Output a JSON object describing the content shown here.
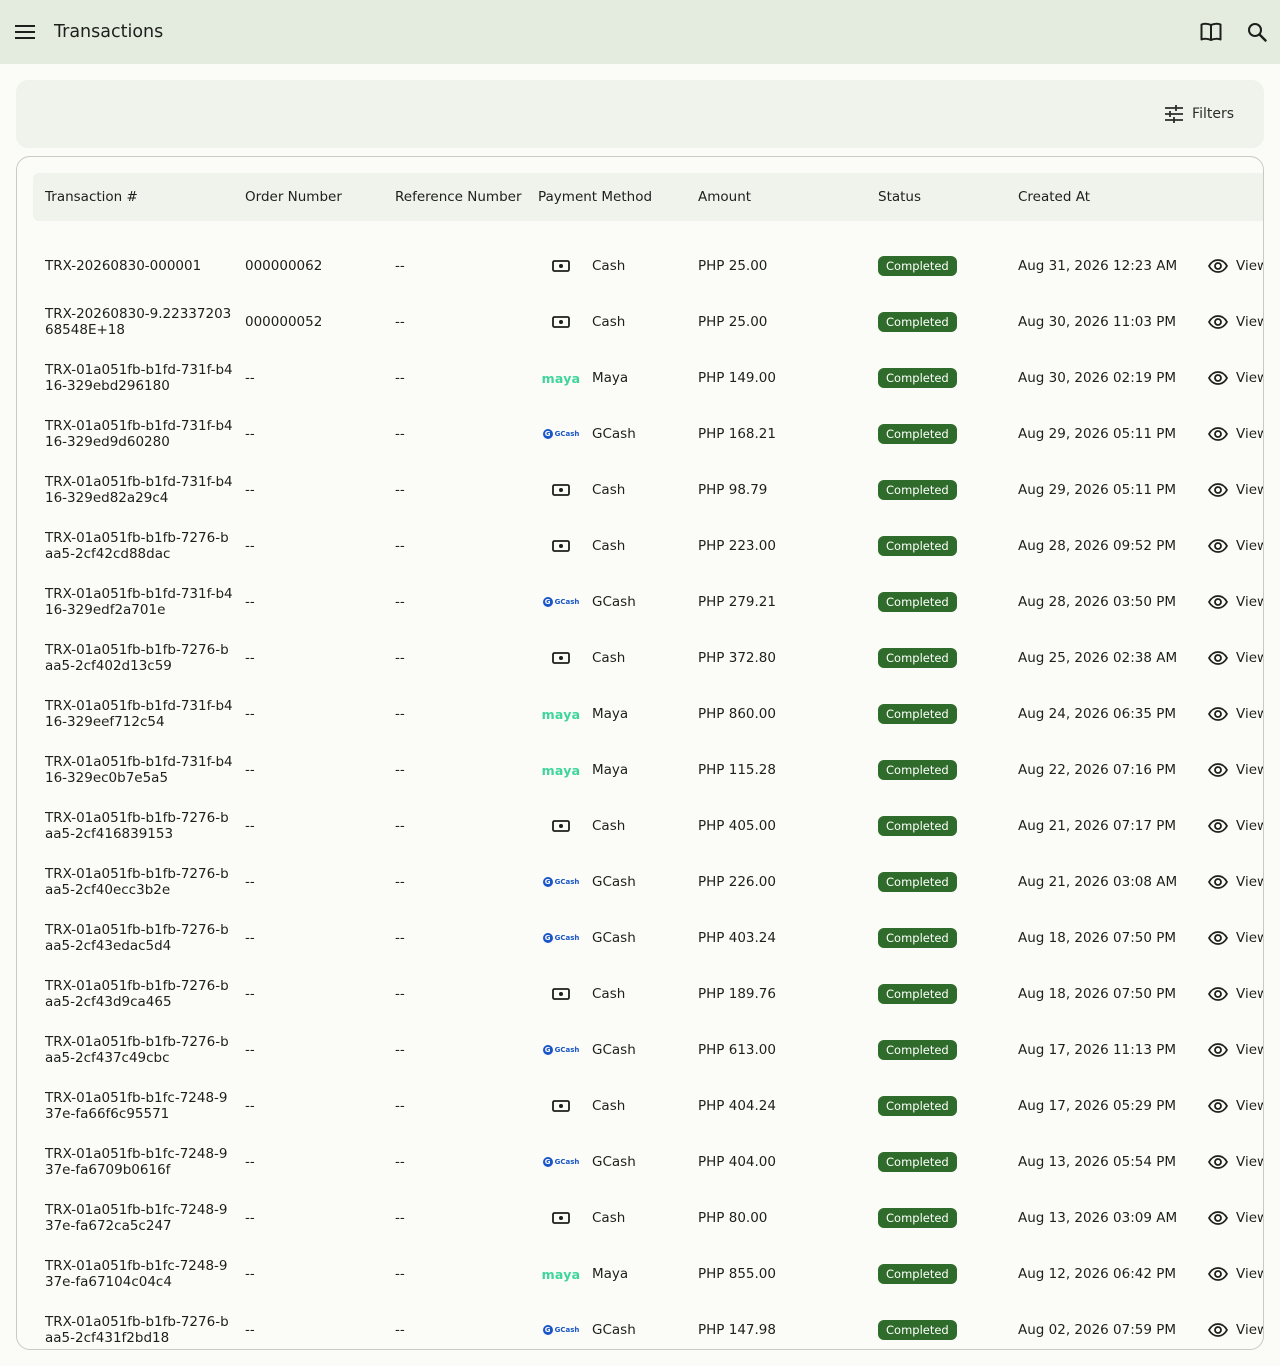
{
  "header": {
    "title": "Transactions",
    "menu_icon": "menu-icon",
    "book_icon": "book-icon",
    "search_icon": "search-icon"
  },
  "filters": {
    "label": "Filters",
    "icon": "tune-icon"
  },
  "table": {
    "columns": [
      "Transaction #",
      "Order Number",
      "Reference Number",
      "Payment Method",
      "Amount",
      "Status",
      "Created At"
    ],
    "view_label": "View",
    "rows": [
      {
        "txn": "TRX-20260830-000001",
        "order": "000000062",
        "ref": "--",
        "method": "Cash",
        "amount": "PHP 25.00",
        "status": "Completed",
        "created": "Aug 31, 2026 12:23 AM"
      },
      {
        "txn": "TRX-20260830-9.2233720368548E+18",
        "order": "000000052",
        "ref": "--",
        "method": "Cash",
        "amount": "PHP 25.00",
        "status": "Completed",
        "created": "Aug 30, 2026 11:03 PM"
      },
      {
        "txn": "TRX-01a051fb-b1fd-731f-b416-329ebd296180",
        "order": "--",
        "ref": "--",
        "method": "Maya",
        "amount": "PHP 149.00",
        "status": "Completed",
        "created": "Aug 30, 2026 02:19 PM"
      },
      {
        "txn": "TRX-01a051fb-b1fd-731f-b416-329ed9d60280",
        "order": "--",
        "ref": "--",
        "method": "GCash",
        "amount": "PHP 168.21",
        "status": "Completed",
        "created": "Aug 29, 2026 05:11 PM"
      },
      {
        "txn": "TRX-01a051fb-b1fd-731f-b416-329ed82a29c4",
        "order": "--",
        "ref": "--",
        "method": "Cash",
        "amount": "PHP 98.79",
        "status": "Completed",
        "created": "Aug 29, 2026 05:11 PM"
      },
      {
        "txn": "TRX-01a051fb-b1fb-7276-baa5-2cf42cd88dac",
        "order": "--",
        "ref": "--",
        "method": "Cash",
        "amount": "PHP 223.00",
        "status": "Completed",
        "created": "Aug 28, 2026 09:52 PM"
      },
      {
        "txn": "TRX-01a051fb-b1fd-731f-b416-329edf2a701e",
        "order": "--",
        "ref": "--",
        "method": "GCash",
        "amount": "PHP 279.21",
        "status": "Completed",
        "created": "Aug 28, 2026 03:50 PM"
      },
      {
        "txn": "TRX-01a051fb-b1fb-7276-baa5-2cf402d13c59",
        "order": "--",
        "ref": "--",
        "method": "Cash",
        "amount": "PHP 372.80",
        "status": "Completed",
        "created": "Aug 25, 2026 02:38 AM"
      },
      {
        "txn": "TRX-01a051fb-b1fd-731f-b416-329eef712c54",
        "order": "--",
        "ref": "--",
        "method": "Maya",
        "amount": "PHP 860.00",
        "status": "Completed",
        "created": "Aug 24, 2026 06:35 PM"
      },
      {
        "txn": "TRX-01a051fb-b1fd-731f-b416-329ec0b7e5a5",
        "order": "--",
        "ref": "--",
        "method": "Maya",
        "amount": "PHP 115.28",
        "status": "Completed",
        "created": "Aug 22, 2026 07:16 PM"
      },
      {
        "txn": "TRX-01a051fb-b1fb-7276-baa5-2cf416839153",
        "order": "--",
        "ref": "--",
        "method": "Cash",
        "amount": "PHP 405.00",
        "status": "Completed",
        "created": "Aug 21, 2026 07:17 PM"
      },
      {
        "txn": "TRX-01a051fb-b1fb-7276-baa5-2cf40ecc3b2e",
        "order": "--",
        "ref": "--",
        "method": "GCash",
        "amount": "PHP 226.00",
        "status": "Completed",
        "created": "Aug 21, 2026 03:08 AM"
      },
      {
        "txn": "TRX-01a051fb-b1fb-7276-baa5-2cf43edac5d4",
        "order": "--",
        "ref": "--",
        "method": "GCash",
        "amount": "PHP 403.24",
        "status": "Completed",
        "created": "Aug 18, 2026 07:50 PM"
      },
      {
        "txn": "TRX-01a051fb-b1fb-7276-baa5-2cf43d9ca465",
        "order": "--",
        "ref": "--",
        "method": "Cash",
        "amount": "PHP 189.76",
        "status": "Completed",
        "created": "Aug 18, 2026 07:50 PM"
      },
      {
        "txn": "TRX-01a051fb-b1fb-7276-baa5-2cf437c49cbc",
        "order": "--",
        "ref": "--",
        "method": "GCash",
        "amount": "PHP 613.00",
        "status": "Completed",
        "created": "Aug 17, 2026 11:13 PM"
      },
      {
        "txn": "TRX-01a051fb-b1fc-7248-937e-fa66f6c95571",
        "order": "--",
        "ref": "--",
        "method": "Cash",
        "amount": "PHP 404.24",
        "status": "Completed",
        "created": "Aug 17, 2026 05:29 PM"
      },
      {
        "txn": "TRX-01a051fb-b1fc-7248-937e-fa6709b0616f",
        "order": "--",
        "ref": "--",
        "method": "GCash",
        "amount": "PHP 404.00",
        "status": "Completed",
        "created": "Aug 13, 2026 05:54 PM"
      },
      {
        "txn": "TRX-01a051fb-b1fc-7248-937e-fa672ca5c247",
        "order": "--",
        "ref": "--",
        "method": "Cash",
        "amount": "PHP 80.00",
        "status": "Completed",
        "created": "Aug 13, 2026 03:09 AM"
      },
      {
        "txn": "TRX-01a051fb-b1fc-7248-937e-fa67104c04c4",
        "order": "--",
        "ref": "--",
        "method": "Maya",
        "amount": "PHP 855.00",
        "status": "Completed",
        "created": "Aug 12, 2026 06:42 PM"
      },
      {
        "txn": "TRX-01a051fb-b1fb-7276-baa5-2cf431f2bd18",
        "order": "--",
        "ref": "--",
        "method": "GCash",
        "amount": "PHP 147.98",
        "status": "Completed",
        "created": "Aug 02, 2026 07:59 PM"
      }
    ]
  },
  "logos": {
    "maya": "maya",
    "gcash": "GCash"
  },
  "colors": {
    "app_bar": "#e4ebdf",
    "status_completed": "#2f6b2a",
    "maya": "#3ed59a",
    "gcash": "#1a55c8"
  }
}
